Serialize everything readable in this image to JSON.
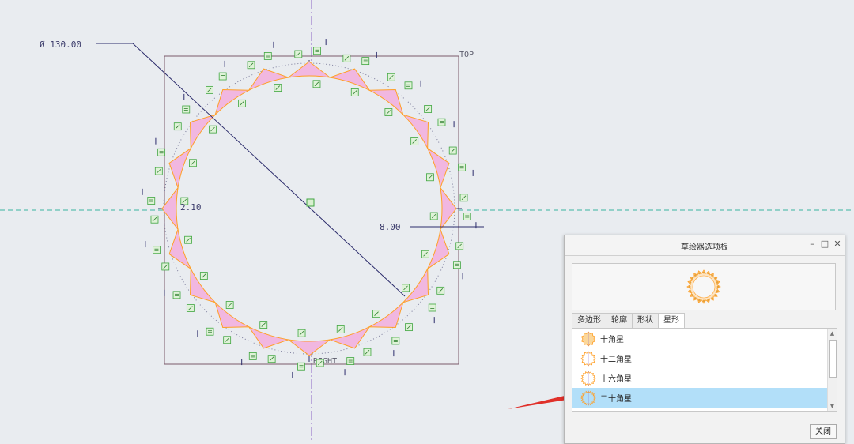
{
  "canvas": {
    "diameter_label": "Ø 130.00",
    "top_label": "TOP",
    "right_label": "RIGHT",
    "dim_8_label": "8.00",
    "dim_2_label": "2.10",
    "star_points": 20
  },
  "palette": {
    "title": "草绘器选项板",
    "tabs": [
      {
        "label": "多边形"
      },
      {
        "label": "轮廓"
      },
      {
        "label": "形状"
      },
      {
        "label": "星形"
      }
    ],
    "active_tab": 3,
    "items": [
      {
        "label": "十角星"
      },
      {
        "label": "十二角星"
      },
      {
        "label": "十六角星"
      },
      {
        "label": "二十角星"
      }
    ],
    "selected_item": 3,
    "close_label": "关闭"
  },
  "colors": {
    "background": "#e9ecf0",
    "sketch_fill": "#f1b7e0",
    "sketch_line": "#ff9f26",
    "constraint_green": "#3fa53f",
    "selection": "#b2dff9",
    "annotation_arrow": "#e0302a"
  }
}
